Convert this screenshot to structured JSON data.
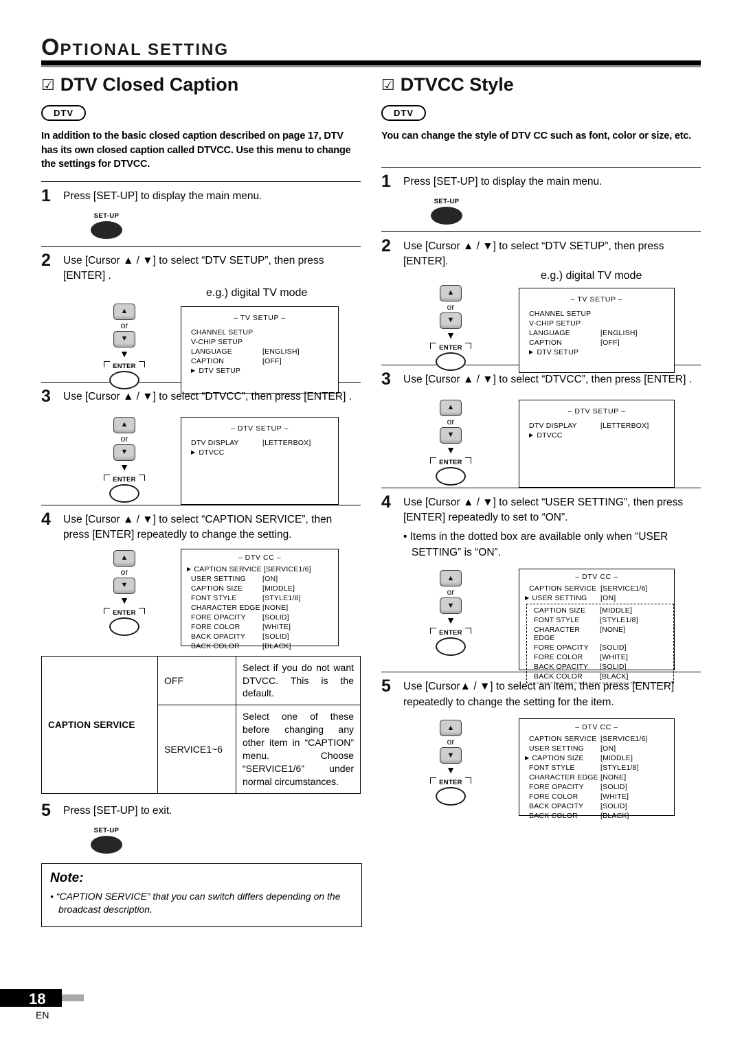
{
  "header": {
    "title_first": "O",
    "title_rest": "PTIONAL  SETTING"
  },
  "left": {
    "heading": "DTV Closed Caption",
    "check": "☑",
    "badge": "DTV",
    "intro": "In addition to the basic closed caption described on page 17, DTV has its own closed caption called DTVCC. Use this menu to change the settings for DTVCC.",
    "steps": [
      {
        "num": "1",
        "text": "Press [SET-UP] to display the main menu."
      },
      {
        "num": "2",
        "text": "Use [Cursor ▲ / ▼] to select “DTV SETUP”, then press [ENTER] ."
      },
      {
        "num": "3",
        "text": "Use [Cursor ▲ / ▼] to select “DTVCC”, then press [ENTER] ."
      },
      {
        "num": "4",
        "text": "Use [Cursor ▲ / ▼] to select “CAPTION SERVICE”, then press [ENTER] repeatedly to change the setting."
      },
      {
        "num": "5",
        "text": "Press [SET-UP] to exit."
      }
    ],
    "eg_label": "e.g.) digital TV mode",
    "setup_key": "SET-UP",
    "enter_key": "ENTER",
    "or": "or",
    "tv_setup": {
      "title": "– TV SETUP –",
      "rows": [
        {
          "label": "CHANNEL SETUP",
          "value": ""
        },
        {
          "label": "V-CHIP SETUP",
          "value": ""
        },
        {
          "label": "LANGUAGE",
          "value": "[ENGLISH]"
        },
        {
          "label": "CAPTION",
          "value": "[OFF]"
        }
      ],
      "selected": "DTV SETUP"
    },
    "dtv_setup": {
      "title": "– DTV SETUP –",
      "rows": [
        {
          "label": "DTV DISPLAY",
          "value": "[LETTERBOX]"
        }
      ],
      "selected": "DTVCC"
    },
    "dtv_cc": {
      "title": "– DTV CC –",
      "selected": "CAPTION SERVICE",
      "selected_value": "[SERVICE1/6]",
      "rows": [
        {
          "label": "USER SETTING",
          "value": "[ON]"
        },
        {
          "label": "CAPTION SIZE",
          "value": "[MIDDLE]"
        },
        {
          "label": "FONT STYLE",
          "value": "[STYLE1/8]"
        },
        {
          "label": "CHARACTER EDGE",
          "value": "[NONE]"
        },
        {
          "label": "FORE OPACITY",
          "value": "[SOLID]"
        },
        {
          "label": "FORE COLOR",
          "value": "[WHITE]"
        },
        {
          "label": "BACK OPACITY",
          "value": "[SOLID]"
        },
        {
          "label": "BACK COLOR",
          "value": "[BLACK]"
        }
      ]
    },
    "table": {
      "row_label": "CAPTION SERVICE",
      "rows": [
        {
          "option": "OFF",
          "desc": "Select if you do not want DTVCC. This is the default."
        },
        {
          "option": "SERVICE1~6",
          "desc": "Select one of these before changing any other item in “CAPTION” menu. Choose “SERVICE1/6” under normal circumstances."
        }
      ]
    },
    "note": {
      "title": "Note:",
      "text": "• “CAPTION SERVICE” that you can switch differs depending on the broadcast description."
    }
  },
  "right": {
    "heading": "DTVCC Style",
    "check": "☑",
    "badge": "DTV",
    "intro": "You can change the style of DTV CC such as font, color or size, etc.",
    "steps": [
      {
        "num": "1",
        "text": "Press [SET-UP] to display the main menu."
      },
      {
        "num": "2",
        "text": "Use [Cursor ▲ / ▼] to select “DTV SETUP”, then press [ENTER]."
      },
      {
        "num": "3",
        "text": "Use [Cursor ▲ / ▼] to select “DTVCC”, then press [ENTER] ."
      },
      {
        "num": "4",
        "text": "Use [Cursor ▲ / ▼] to select “USER SETTING”, then press [ENTER] repeatedly to set to “ON”."
      },
      {
        "num": "5",
        "text": "Use [Cursor▲ / ▼] to select an item, then press [ENTER] repeatedly to change the setting for the item."
      }
    ],
    "bullet4": "• Items in the dotted box are available only when “USER SETTING” is “ON”.",
    "eg_label": "e.g.) digital TV mode",
    "setup_key": "SET-UP",
    "enter_key": "ENTER",
    "or": "or",
    "tv_setup": {
      "title": "– TV SETUP –",
      "rows": [
        {
          "label": "CHANNEL SETUP",
          "value": ""
        },
        {
          "label": "V-CHIP SETUP",
          "value": ""
        },
        {
          "label": "LANGUAGE",
          "value": "[ENGLISH]"
        },
        {
          "label": "CAPTION",
          "value": "[OFF]"
        }
      ],
      "selected": "DTV SETUP"
    },
    "dtv_setup": {
      "title": "– DTV SETUP –",
      "rows": [
        {
          "label": "DTV DISPLAY",
          "value": "[LETTERBOX]"
        }
      ],
      "selected": "DTVCC"
    },
    "dtv_cc_step4": {
      "title": "– DTV CC –",
      "first": {
        "label": "CAPTION SERVICE",
        "value": "[SERVICE1/6]"
      },
      "selected": "USER SETTING",
      "selected_value": "[ON]",
      "dotted_rows": [
        {
          "label": "CAPTION SIZE",
          "value": "[MIDDLE]"
        },
        {
          "label": "FONT STYLE",
          "value": "[STYLE1/8]"
        },
        {
          "label": "CHARACTER EDGE",
          "value": "[NONE]"
        },
        {
          "label": "FORE OPACITY",
          "value": "[SOLID]"
        },
        {
          "label": "FORE COLOR",
          "value": "[WHITE]"
        },
        {
          "label": "BACK OPACITY",
          "value": "[SOLID]"
        },
        {
          "label": "BACK COLOR",
          "value": "[BLACK]"
        }
      ]
    },
    "dtv_cc_step5": {
      "title": "– DTV CC –",
      "rows_top": [
        {
          "label": "CAPTION SERVICE",
          "value": "[SERVICE1/6]"
        },
        {
          "label": "USER SETTING",
          "value": "[ON]"
        }
      ],
      "selected": "CAPTION SIZE",
      "selected_value": "[MIDDLE]",
      "rows_bottom": [
        {
          "label": "FONT STYLE",
          "value": "[STYLE1/8]"
        },
        {
          "label": "CHARACTER EDGE",
          "value": "[NONE]"
        },
        {
          "label": "FORE OPACITY",
          "value": "[SOLID]"
        },
        {
          "label": "FORE COLOR",
          "value": "[WHITE]"
        },
        {
          "label": "BACK OPACITY",
          "value": "[SOLID]"
        },
        {
          "label": "BACK COLOR",
          "value": "[BLACK]"
        }
      ]
    }
  },
  "footer": {
    "page": "18",
    "lang": "EN"
  }
}
